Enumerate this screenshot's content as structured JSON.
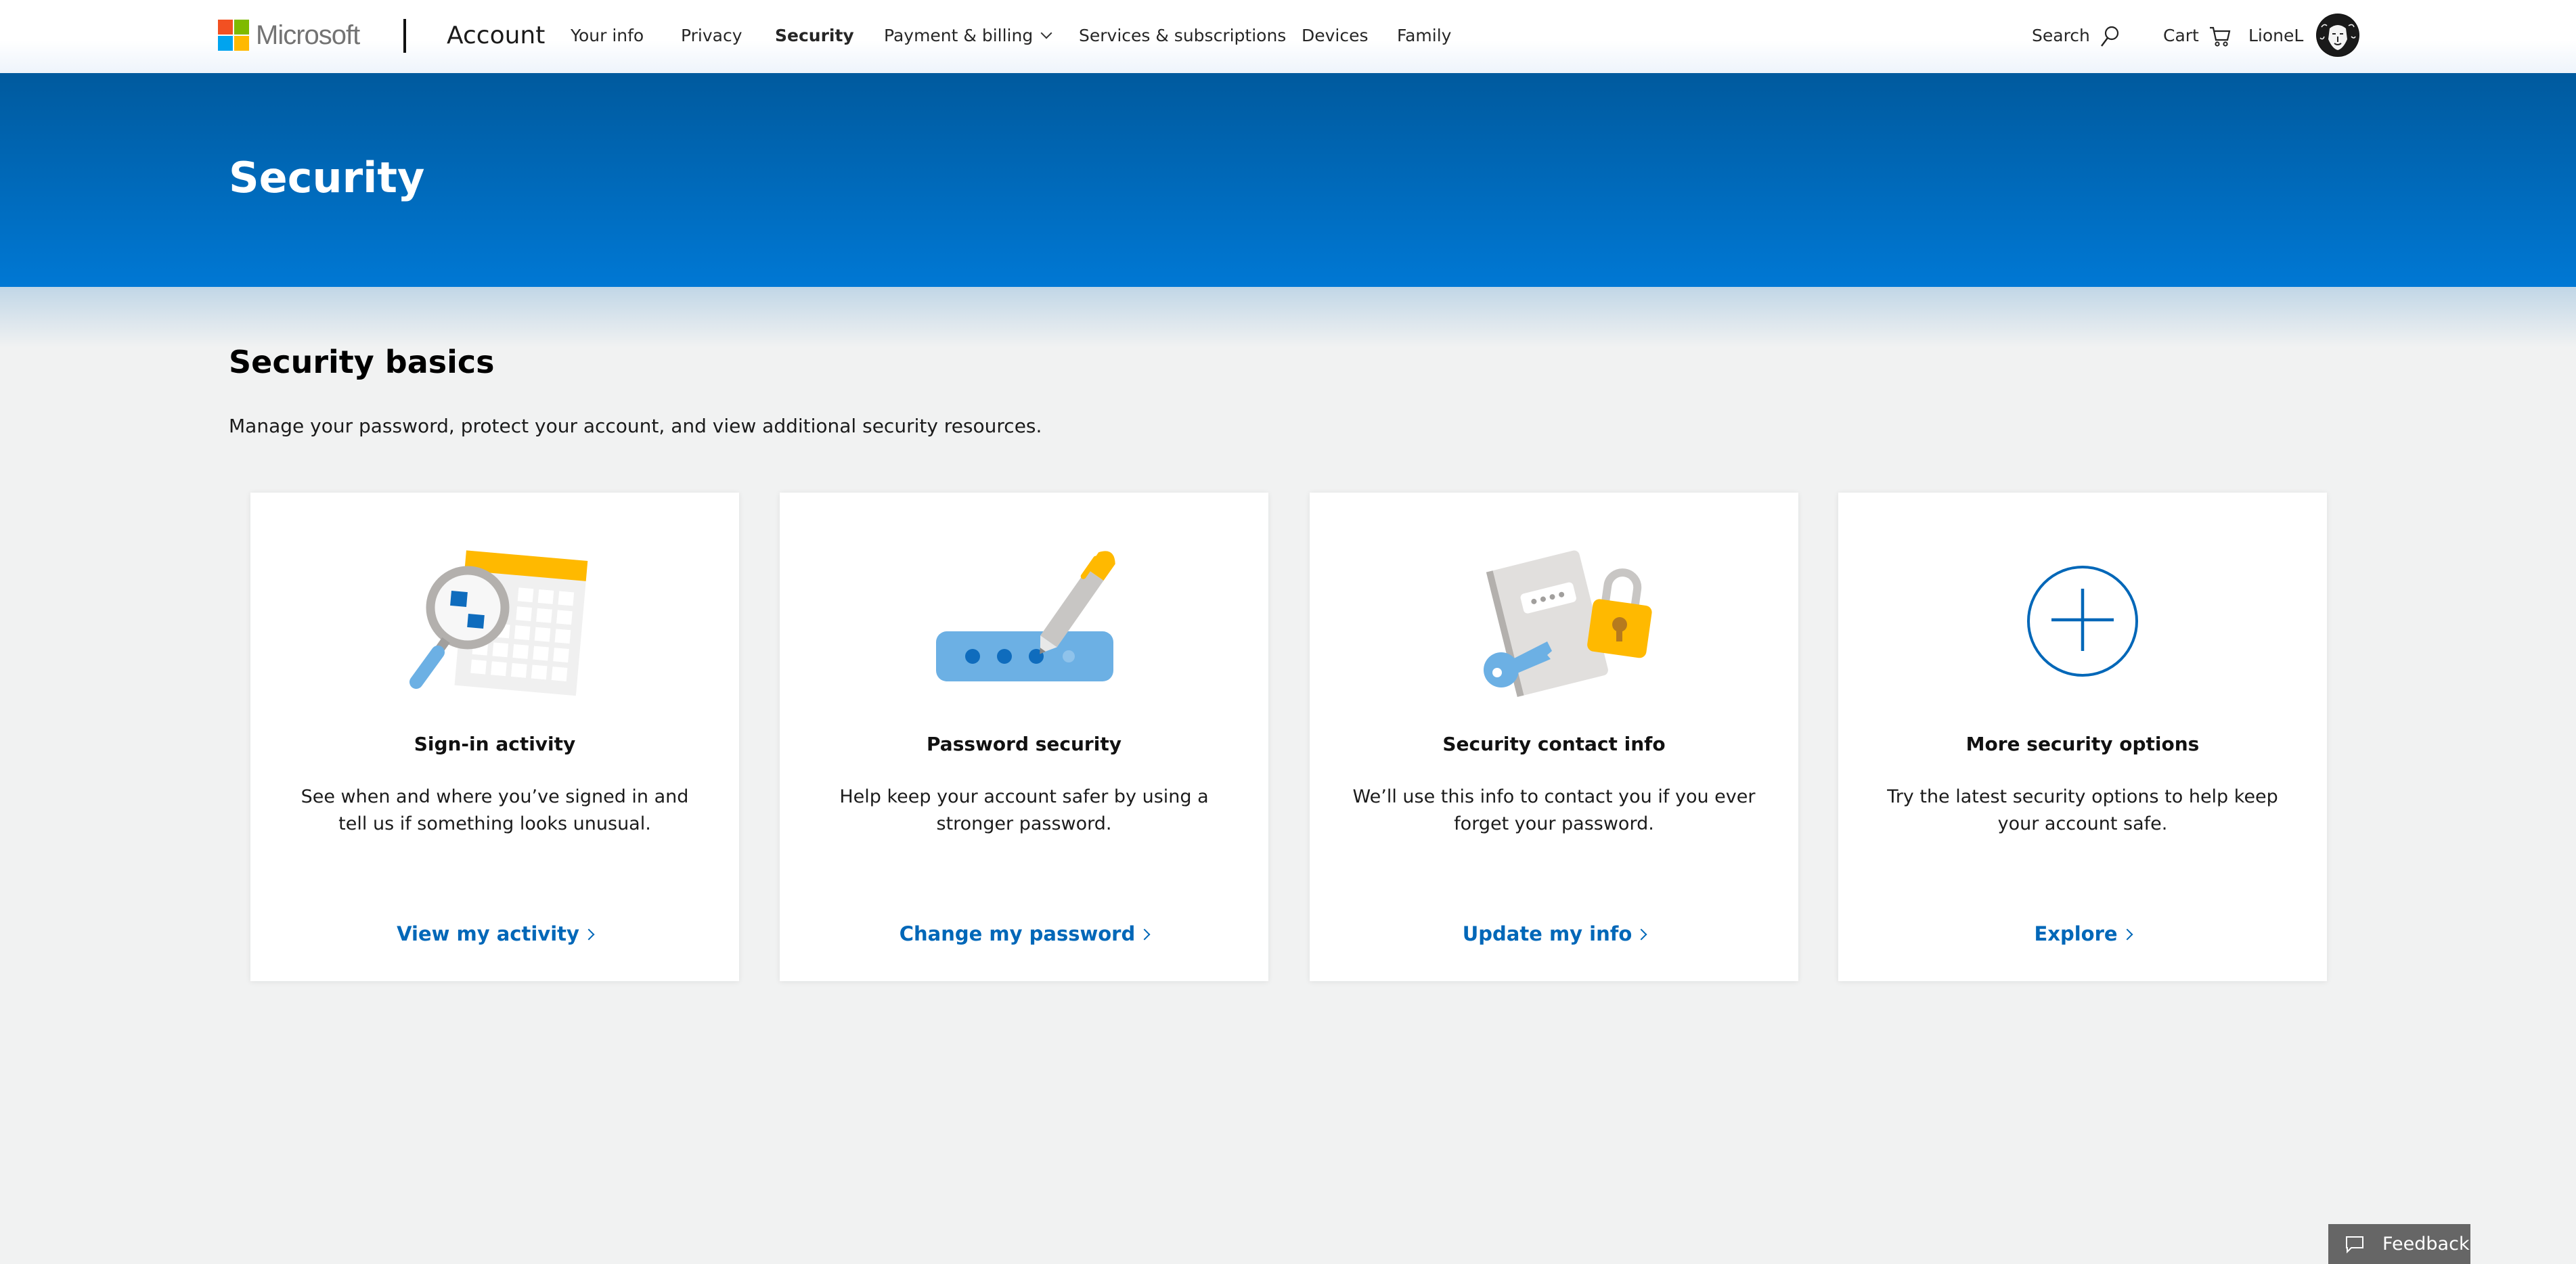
{
  "header": {
    "brand": "Microsoft",
    "brand_colors": [
      "#f25022",
      "#7fba00",
      "#00a4ef",
      "#ffb900"
    ],
    "section_label": "Account",
    "nav": [
      {
        "label": "Your info",
        "active": false
      },
      {
        "label": "Privacy",
        "active": false
      },
      {
        "label": "Security",
        "active": true
      },
      {
        "label": "Payment & billing",
        "active": false,
        "has_dropdown": true
      },
      {
        "label": "Services & subscriptions",
        "active": false
      },
      {
        "label": "Devices",
        "active": false
      },
      {
        "label": "Family",
        "active": false
      }
    ],
    "search_label": "Search",
    "search_icon": "search-icon",
    "cart_label": "Cart",
    "cart_icon": "cart-icon",
    "user_name": "LioneL",
    "avatar_icon": "lion-avatar"
  },
  "hero": {
    "title": "Security",
    "gradient": [
      "#005a9e",
      "#0078d4"
    ]
  },
  "section": {
    "title": "Security basics",
    "description": "Manage your password, protect your account, and view additional security resources."
  },
  "cards": [
    {
      "title": "Sign-in activity",
      "description": "See when and where you’ve signed in and tell us if something looks unusual.",
      "link": "View my activity",
      "icon": "calendar-magnifier-illustration"
    },
    {
      "title": "Password security",
      "description": "Help keep your account safer by using a stronger password.",
      "link": "Change my password",
      "icon": "password-pen-illustration"
    },
    {
      "title": "Security contact info",
      "description": "We’ll use this info to contact you if you ever forget your password.",
      "link": "Update my info",
      "icon": "notebook-key-lock-illustration"
    },
    {
      "title": "More security options",
      "description": "Try the latest security options to help keep your account safe.",
      "link": "Explore",
      "icon": "plus-circle-icon"
    }
  ],
  "feedback": {
    "label": "Feedback",
    "icon": "chat-bubble-icon"
  },
  "colors": {
    "accent": "#0067b8",
    "page_bg": "#f1f2f2",
    "feedback_bg": "#666666"
  }
}
